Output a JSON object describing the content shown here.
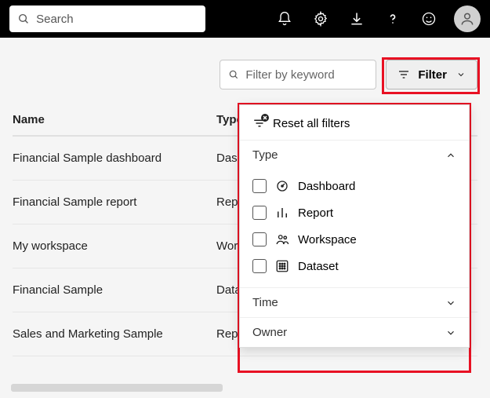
{
  "topbar": {
    "search_placeholder": "Search"
  },
  "toolbar": {
    "keyword_placeholder": "Filter by keyword",
    "filter_label": "Filter"
  },
  "table": {
    "headers": {
      "name": "Name",
      "type": "Type"
    },
    "rows": [
      {
        "name": "Financial Sample dashboard",
        "type": "Dashboard"
      },
      {
        "name": "Financial Sample report",
        "type": "Report"
      },
      {
        "name": "My workspace",
        "type": "Workspace"
      },
      {
        "name": "Financial Sample",
        "type": "Dataset"
      },
      {
        "name": "Sales and Marketing Sample",
        "type": "Report"
      }
    ]
  },
  "filter_panel": {
    "reset_label": "Reset all filters",
    "sections": {
      "type": {
        "label": "Type",
        "expanded": true,
        "options": [
          {
            "label": "Dashboard"
          },
          {
            "label": "Report"
          },
          {
            "label": "Workspace"
          },
          {
            "label": "Dataset"
          }
        ]
      },
      "time": {
        "label": "Time",
        "expanded": false
      },
      "owner": {
        "label": "Owner",
        "expanded": false
      }
    }
  }
}
